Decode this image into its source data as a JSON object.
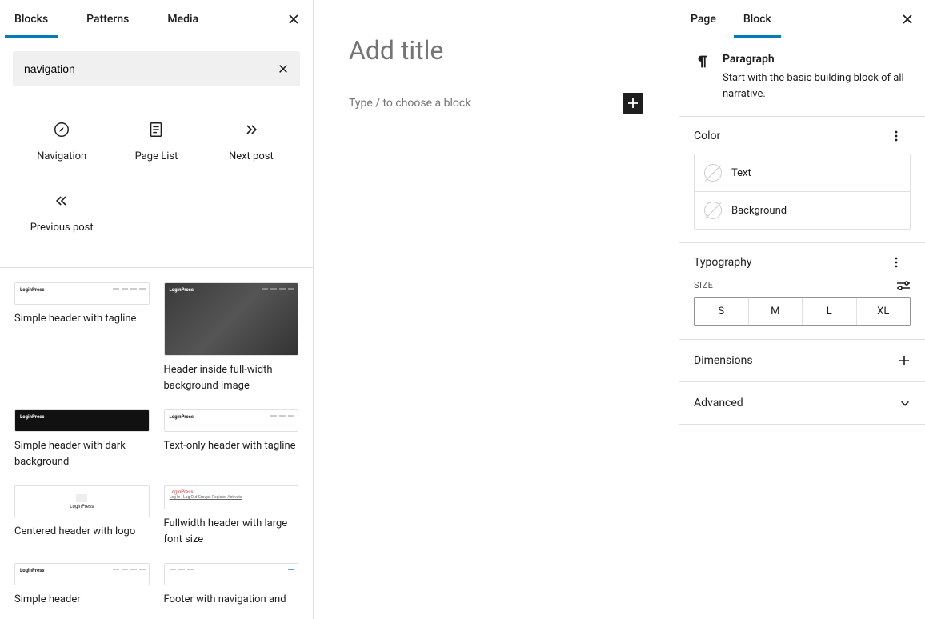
{
  "inserter": {
    "tabs": {
      "blocks": "Blocks",
      "patterns": "Patterns",
      "media": "Media"
    },
    "search": {
      "value": "navigation"
    },
    "blocks": [
      {
        "label": "Navigation",
        "icon": "compass"
      },
      {
        "label": "Page List",
        "icon": "pagelist"
      },
      {
        "label": "Next post",
        "icon": "next"
      },
      {
        "label": "Previous post",
        "icon": "prev"
      }
    ],
    "patterns": [
      {
        "label": "Simple header with tagline"
      },
      {
        "label": "Header inside full-width background image"
      },
      {
        "label": "Simple header with dark background"
      },
      {
        "label": "Text-only header with tagline"
      },
      {
        "label": "Centered header with logo"
      },
      {
        "label": "Fullwidth header with large font size"
      },
      {
        "label": "Simple header"
      },
      {
        "label": "Footer with navigation and"
      }
    ],
    "preview_brand": "LoginPress",
    "preview_links": "Log In | Log Out   Groups   Register   Activate"
  },
  "canvas": {
    "title_placeholder": "Add title",
    "paragraph_placeholder": "Type / to choose a block"
  },
  "settings": {
    "tabs": {
      "page": "Page",
      "block": "Block"
    },
    "block_info": {
      "title": "Paragraph",
      "description": "Start with the basic building block of all narrative."
    },
    "panels": {
      "color": {
        "title": "Color",
        "text": "Text",
        "background": "Background"
      },
      "typography": {
        "title": "Typography",
        "size_label": "SIZE",
        "sizes": [
          "S",
          "M",
          "L",
          "XL"
        ]
      },
      "dimensions": "Dimensions",
      "advanced": "Advanced"
    }
  }
}
